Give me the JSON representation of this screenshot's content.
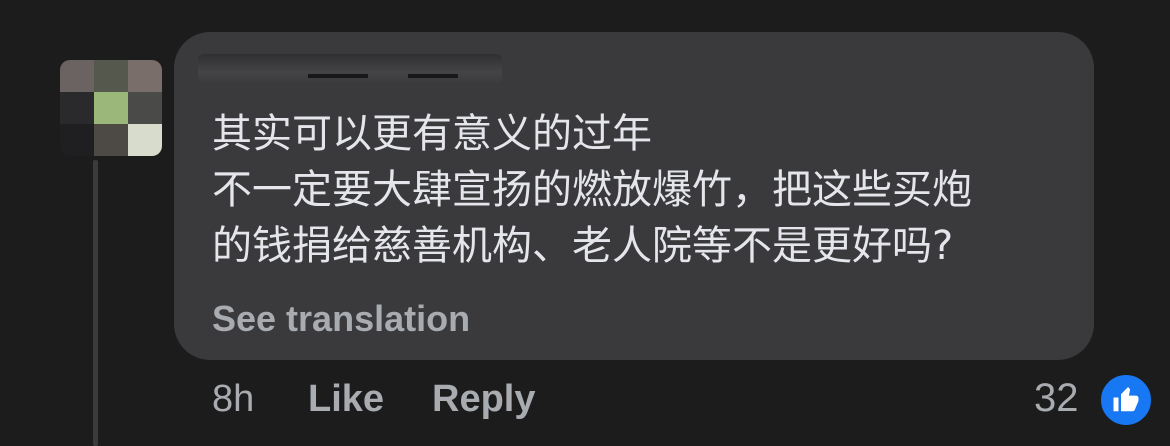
{
  "comment": {
    "lines": [
      "其实可以更有意义的过年",
      "不一定要大肆宣扬的燃放爆竹，把这些买炮",
      "的钱捐给慈善机构、老人院等不是更好吗?"
    ],
    "see_translation": "See translation"
  },
  "meta": {
    "time": "8h",
    "like_label": "Like",
    "reply_label": "Reply"
  },
  "reactions": {
    "count": "32",
    "icon": "thumbs-up-icon",
    "color": "#1877f2"
  }
}
